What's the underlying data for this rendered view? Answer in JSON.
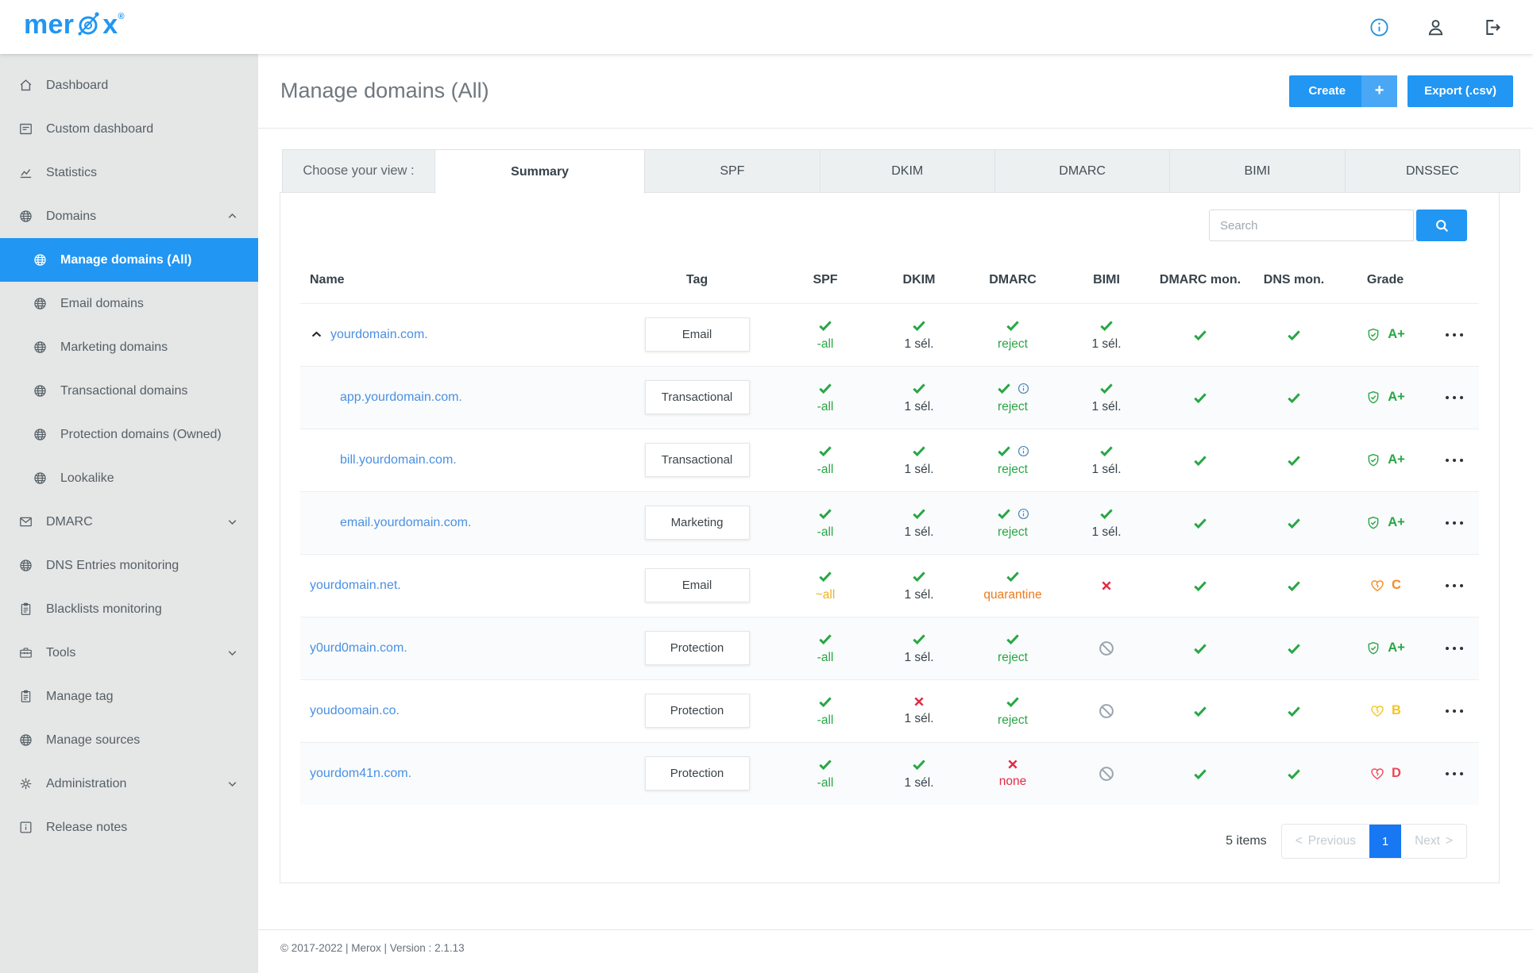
{
  "topbar": {
    "logo_pre": "mer",
    "logo_post": "x",
    "logo_reg": "®",
    "icons": [
      "info-circle-icon",
      "user-icon",
      "logout-icon"
    ]
  },
  "sidebar": {
    "items": [
      {
        "label": "Dashboard",
        "icon": "home-icon",
        "level": 0
      },
      {
        "label": "Custom dashboard",
        "icon": "custom-dashboard-icon",
        "level": 0
      },
      {
        "label": "Statistics",
        "icon": "statistics-icon",
        "level": 0
      },
      {
        "label": "Domains",
        "icon": "globe-icon",
        "level": 0,
        "chevron": "up"
      },
      {
        "label": "Manage domains (All)",
        "icon": "globe-icon",
        "level": 1,
        "active": true
      },
      {
        "label": "Email domains",
        "icon": "globe-icon",
        "level": 1
      },
      {
        "label": "Marketing domains",
        "icon": "globe-icon",
        "level": 1
      },
      {
        "label": "Transactional domains",
        "icon": "globe-icon",
        "level": 1
      },
      {
        "label": "Protection domains (Owned)",
        "icon": "globe-icon",
        "level": 1
      },
      {
        "label": "Lookalike",
        "icon": "globe-icon",
        "level": 1
      },
      {
        "label": "DMARC",
        "icon": "mail-icon",
        "level": 0,
        "chevron": "down"
      },
      {
        "label": "DNS Entries monitoring",
        "icon": "globe-icon",
        "level": 0
      },
      {
        "label": "Blacklists monitoring",
        "icon": "clipboard-icon",
        "level": 0
      },
      {
        "label": "Tools",
        "icon": "toolbox-icon",
        "level": 0,
        "chevron": "down"
      },
      {
        "label": "Manage tag",
        "icon": "clipboard-icon",
        "level": 0
      },
      {
        "label": "Manage sources",
        "icon": "globe-icon",
        "level": 0
      },
      {
        "label": "Administration",
        "icon": "gear-icon",
        "level": 0,
        "chevron": "down"
      },
      {
        "label": "Release notes",
        "icon": "info-square-icon",
        "level": 0
      }
    ]
  },
  "header": {
    "title": "Manage domains (All)",
    "create_label": "Create",
    "create_plus": "+",
    "export_label": "Export (.csv)"
  },
  "tabs": {
    "label": "Choose your view :",
    "items": [
      {
        "label": "Summary",
        "active": true
      },
      {
        "label": "SPF"
      },
      {
        "label": "DKIM"
      },
      {
        "label": "DMARC"
      },
      {
        "label": "BIMI"
      },
      {
        "label": "DNSSEC"
      }
    ]
  },
  "search": {
    "placeholder": "Search"
  },
  "table": {
    "columns": [
      "Name",
      "Tag",
      "SPF",
      "DKIM",
      "DMARC",
      "BIMI",
      "DMARC mon.",
      "DNS mon.",
      "Grade",
      ""
    ],
    "rows": [
      {
        "name": "yourdomain.com.",
        "expander": true,
        "indent": false,
        "tag": "Email",
        "spf": {
          "mark": "check",
          "label": "-all",
          "color": "green"
        },
        "dkim": {
          "mark": "check",
          "label": "1 sél.",
          "color": "dark"
        },
        "dmarc": {
          "mark": "check",
          "info": false,
          "label": "reject",
          "color": "green"
        },
        "bimi": {
          "mark": "check",
          "label": "1 sél.",
          "color": "dark"
        },
        "dmarc_mon": {
          "mark": "check"
        },
        "dns_mon": {
          "mark": "check"
        },
        "grade": {
          "letter": "A+",
          "icon": "shield-check-icon",
          "color_key": "grade_a"
        }
      },
      {
        "name": "app.yourdomain.com.",
        "expander": false,
        "indent": true,
        "tag": "Transactional",
        "spf": {
          "mark": "check",
          "label": "-all",
          "color": "green"
        },
        "dkim": {
          "mark": "check",
          "label": "1 sél.",
          "color": "dark"
        },
        "dmarc": {
          "mark": "check",
          "info": true,
          "label": "reject",
          "color": "green"
        },
        "bimi": {
          "mark": "check",
          "label": "1 sél.",
          "color": "dark"
        },
        "dmarc_mon": {
          "mark": "check"
        },
        "dns_mon": {
          "mark": "check"
        },
        "grade": {
          "letter": "A+",
          "icon": "shield-check-icon",
          "color_key": "grade_a"
        }
      },
      {
        "name": "bill.yourdomain.com.",
        "expander": false,
        "indent": true,
        "tag": "Transactional",
        "spf": {
          "mark": "check",
          "label": "-all",
          "color": "green"
        },
        "dkim": {
          "mark": "check",
          "label": "1 sél.",
          "color": "dark"
        },
        "dmarc": {
          "mark": "check",
          "info": true,
          "label": "reject",
          "color": "green"
        },
        "bimi": {
          "mark": "check",
          "label": "1 sél.",
          "color": "dark"
        },
        "dmarc_mon": {
          "mark": "check"
        },
        "dns_mon": {
          "mark": "check"
        },
        "grade": {
          "letter": "A+",
          "icon": "shield-check-icon",
          "color_key": "grade_a"
        }
      },
      {
        "name": "email.yourdomain.com.",
        "expander": false,
        "indent": true,
        "tag": "Marketing",
        "spf": {
          "mark": "check",
          "label": "-all",
          "color": "green"
        },
        "dkim": {
          "mark": "check",
          "label": "1 sél.",
          "color": "dark"
        },
        "dmarc": {
          "mark": "check",
          "info": true,
          "label": "reject",
          "color": "green"
        },
        "bimi": {
          "mark": "check",
          "label": "1 sél.",
          "color": "dark"
        },
        "dmarc_mon": {
          "mark": "check"
        },
        "dns_mon": {
          "mark": "check"
        },
        "grade": {
          "letter": "A+",
          "icon": "shield-check-icon",
          "color_key": "grade_a"
        }
      },
      {
        "name": "yourdomain.net.",
        "expander": false,
        "indent": false,
        "tag": "Email",
        "spf": {
          "mark": "check",
          "label": "~all",
          "color": "yellow"
        },
        "dkim": {
          "mark": "check",
          "label": "1 sél.",
          "color": "dark"
        },
        "dmarc": {
          "mark": "check",
          "info": false,
          "label": "quarantine",
          "color": "orange"
        },
        "bimi": {
          "mark": "x"
        },
        "dmarc_mon": {
          "mark": "check"
        },
        "dns_mon": {
          "mark": "check"
        },
        "grade": {
          "letter": "C",
          "icon": "heart-crack-icon",
          "color_key": "grade_c"
        }
      },
      {
        "name": "y0urd0main.com.",
        "expander": false,
        "indent": false,
        "tag": "Protection",
        "spf": {
          "mark": "check",
          "label": "-all",
          "color": "green"
        },
        "dkim": {
          "mark": "check",
          "label": "1 sél.",
          "color": "dark"
        },
        "dmarc": {
          "mark": "check",
          "info": false,
          "label": "reject",
          "color": "green"
        },
        "bimi": {
          "mark": "blocked"
        },
        "dmarc_mon": {
          "mark": "check"
        },
        "dns_mon": {
          "mark": "check"
        },
        "grade": {
          "letter": "A+",
          "icon": "shield-check-icon",
          "color_key": "grade_a"
        }
      },
      {
        "name": "youdoomain.co.",
        "expander": false,
        "indent": false,
        "tag": "Protection",
        "spf": {
          "mark": "check",
          "label": "-all",
          "color": "green"
        },
        "dkim": {
          "mark": "x",
          "label": "1 sél.",
          "color": "dark"
        },
        "dmarc": {
          "mark": "check",
          "info": false,
          "label": "reject",
          "color": "green"
        },
        "bimi": {
          "mark": "blocked"
        },
        "dmarc_mon": {
          "mark": "check"
        },
        "dns_mon": {
          "mark": "check"
        },
        "grade": {
          "letter": "B",
          "icon": "heart-crack-icon",
          "color_key": "grade_b"
        }
      },
      {
        "name": "yourdom41n.com.",
        "expander": false,
        "indent": false,
        "tag": "Protection",
        "spf": {
          "mark": "check",
          "label": "-all",
          "color": "green"
        },
        "dkim": {
          "mark": "check",
          "label": "1 sél.",
          "color": "dark"
        },
        "dmarc": {
          "mark": "x",
          "info": false,
          "label": "none",
          "color": "red"
        },
        "bimi": {
          "mark": "blocked"
        },
        "dmarc_mon": {
          "mark": "check"
        },
        "dns_mon": {
          "mark": "check"
        },
        "grade": {
          "letter": "D",
          "icon": "heart-crack-icon",
          "color_key": "grade_d"
        }
      }
    ]
  },
  "pagination": {
    "count": "5 items",
    "prev_arrow": "<",
    "prev": "Previous",
    "page": "1",
    "next": "Next",
    "next_arrow": ">"
  },
  "footer": {
    "text": "© 2017-2022 | Merox | Version : 2.1.13"
  },
  "colors": {
    "green": "#28a745",
    "red": "#e02d45",
    "orange": "#ee7b1c",
    "yellow": "#f2b01e",
    "dark": "#37424a",
    "blue": "#2196f3",
    "link": "#4a90e2",
    "grade_a": "#28a745",
    "grade_b": "#f5c51d",
    "grade_c": "#f58a1f",
    "grade_d": "#ef4655"
  }
}
